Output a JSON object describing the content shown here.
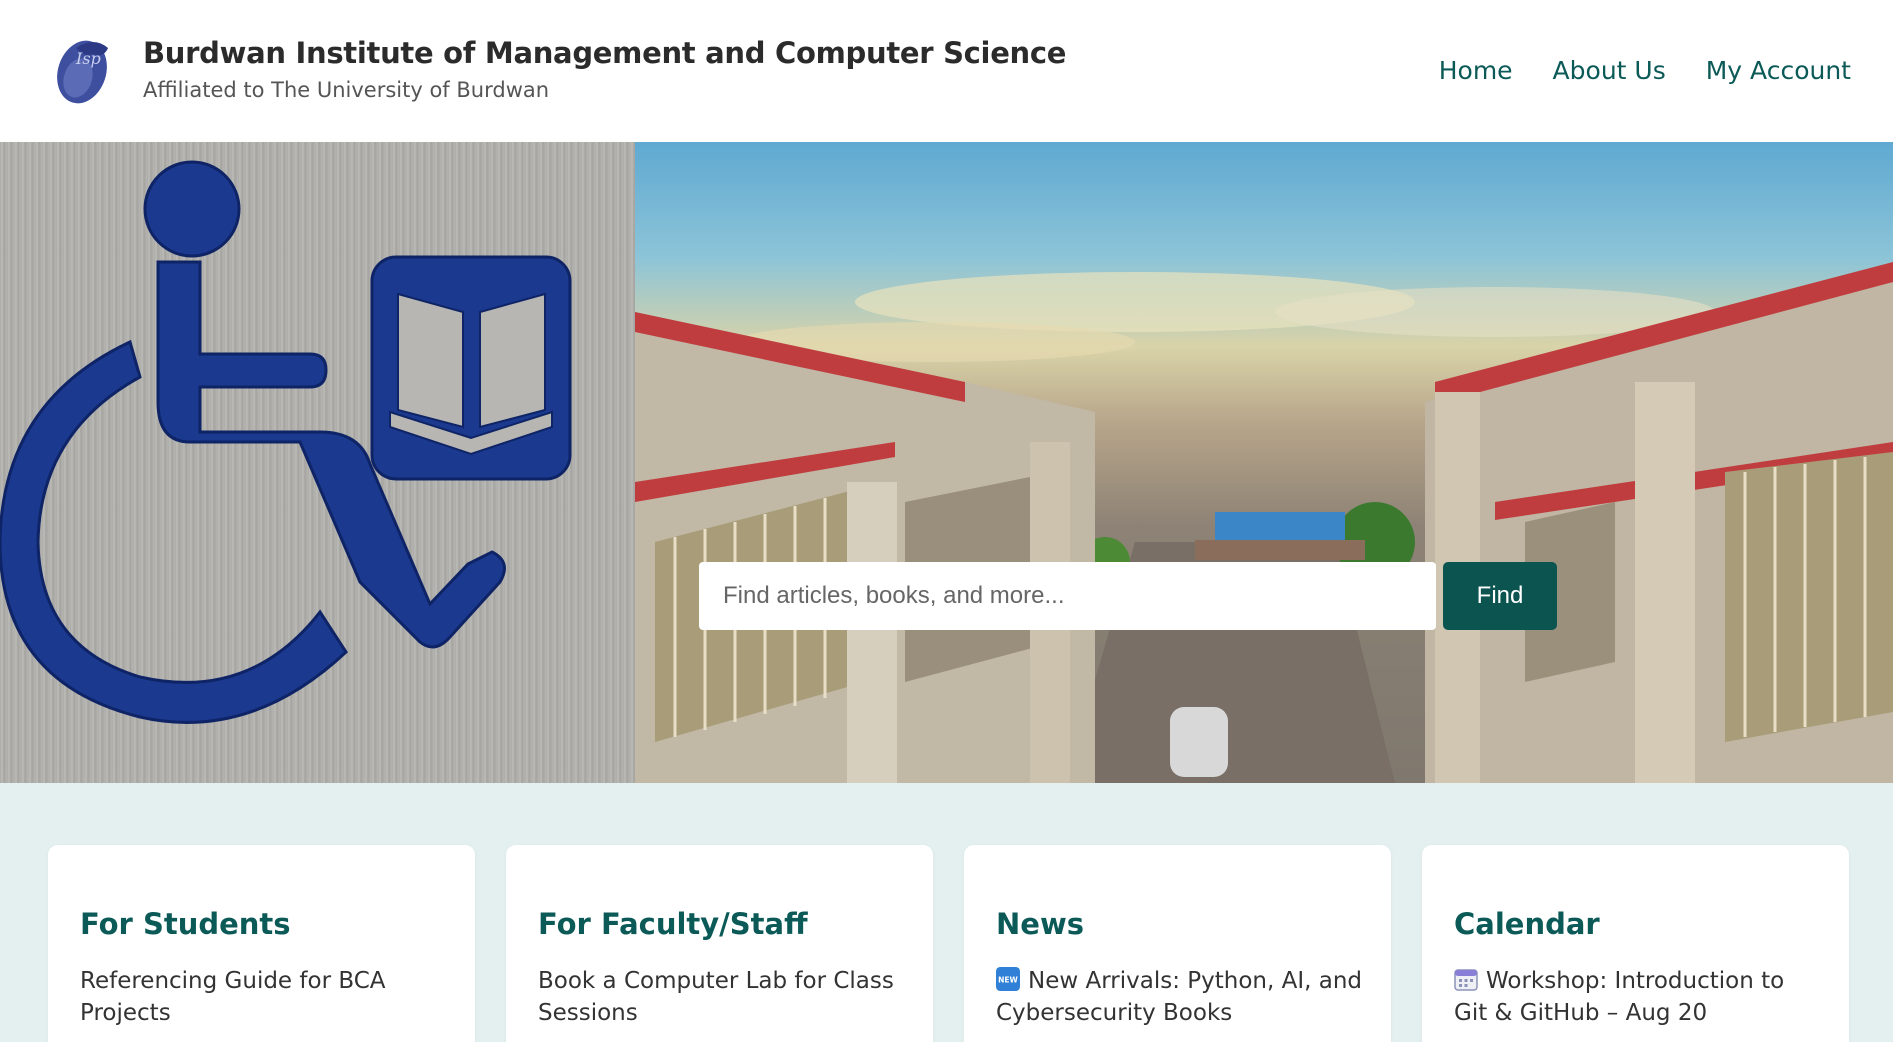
{
  "header": {
    "title": "Burdwan Institute of Management and Computer Science",
    "subtitle": "Affiliated to The University of Burdwan",
    "nav": [
      {
        "label": "Home"
      },
      {
        "label": "About Us"
      },
      {
        "label": "My Account"
      }
    ]
  },
  "search": {
    "placeholder": "Find articles, books, and more...",
    "button_label": "Find"
  },
  "cards": [
    {
      "title": "For Students",
      "text": "Referencing Guide for BCA Projects"
    },
    {
      "title": "For Faculty/Staff",
      "text": "Book a Computer Lab for Class Sessions"
    },
    {
      "title": "News",
      "icon": "new-badge-icon",
      "text": "New Arrivals: Python, AI, and Cybersecurity Books"
    },
    {
      "title": "Calendar",
      "icon": "calendar-icon",
      "text": "Workshop: Introduction to Git & GitHub – Aug 20"
    }
  ],
  "colors": {
    "accent": "#0b5a57",
    "button": "#0b5450",
    "content_bg": "#e4f0f0",
    "symbol_blue": "#1b3a8f"
  }
}
